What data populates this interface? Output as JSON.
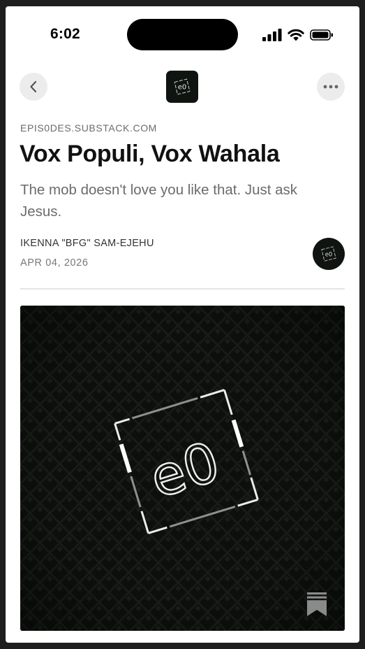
{
  "status_bar": {
    "time": "6:02",
    "icons": [
      "cellular-signal-icon",
      "wifi-icon",
      "battery-icon"
    ]
  },
  "nav": {
    "back_icon": "chevron-left-icon",
    "more_icon": "more-horizontal-icon",
    "publication_logo_text": "e0"
  },
  "post": {
    "domain": "EPIS0DES.SUBSTACK.COM",
    "title": "Vox Populi, Vox Wahala",
    "subtitle": "The mob doesn't love you like that. Just ask Jesus.",
    "author": "IKENNA \"BFG\" SAM-EJEHU",
    "date": "APR 04, 2026",
    "hero_logo_text": "e0",
    "bookmark_icon": "bookmark-stack-icon"
  },
  "colors": {
    "background": "#ffffff",
    "logo_dark": "#0f1410",
    "secondary_text": "#6b6b6b"
  }
}
